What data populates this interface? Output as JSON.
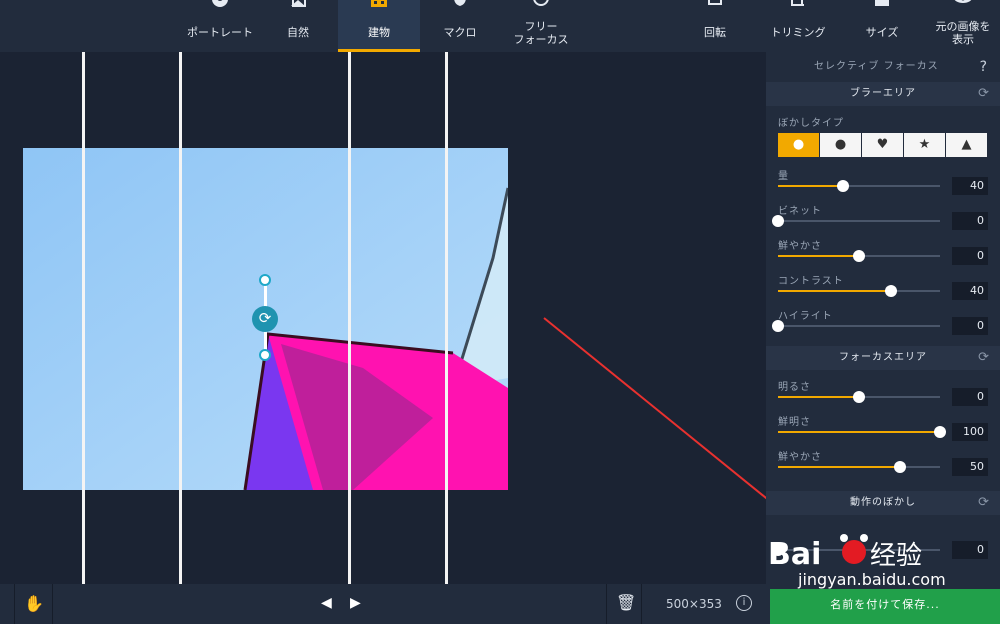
{
  "toolbar": {
    "items": [
      {
        "label": "ポートレート",
        "icon": "portrait-icon"
      },
      {
        "label": "自然",
        "icon": "nature-icon"
      },
      {
        "label": "建物",
        "icon": "building-icon",
        "active": true
      },
      {
        "label": "マクロ",
        "icon": "macro-icon"
      },
      {
        "label": "フリー\nフォーカス",
        "icon": "free-focus-icon"
      },
      {
        "label": "回転",
        "icon": "rotate-icon"
      },
      {
        "label": "トリミング",
        "icon": "crop-icon"
      },
      {
        "label": "サイズ",
        "icon": "resize-icon"
      },
      {
        "label": "元の画像を\n表示",
        "icon": "eye-icon"
      }
    ]
  },
  "panel": {
    "header": "セレクティブ フォーカス",
    "help": "?",
    "blur_section": {
      "title": "ブラーエリア",
      "type_label": "ぼかしタイプ",
      "types": [
        "●",
        "●",
        "♥",
        "★",
        "▲"
      ],
      "sliders": [
        {
          "name": "量",
          "value": "40",
          "level": 0.4
        },
        {
          "name": "ビネット",
          "value": "0",
          "level": 0.0
        },
        {
          "name": "鮮やかさ",
          "value": "0",
          "level": 0.5
        },
        {
          "name": "コントラスト",
          "value": "40",
          "level": 0.7
        },
        {
          "name": "ハイライト",
          "value": "0",
          "level": 0.0
        }
      ]
    },
    "focus_section": {
      "title": "フォーカスエリア",
      "sliders": [
        {
          "name": "明るさ",
          "value": "0",
          "level": 0.5
        },
        {
          "name": "鮮明さ",
          "value": "100",
          "level": 1.0
        },
        {
          "name": "鮮やかさ",
          "value": "50",
          "level": 0.75
        }
      ]
    },
    "motion_section": {
      "title": "動作のぼかし",
      "value": "0"
    }
  },
  "bottom": {
    "dimensions": "500×353",
    "save_label": "名前を付けて保存..."
  },
  "watermark": {
    "text": "jingyan.baidu.com"
  },
  "colors": {
    "accent": "#f2a900",
    "save": "#21a04a",
    "handle": "#1fa8c9"
  }
}
